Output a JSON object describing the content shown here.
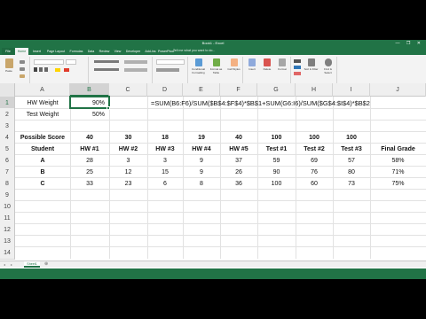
{
  "window": {
    "title": "Book1 - Excel",
    "controls": "—  ❐  ✕"
  },
  "tabs": [
    "File",
    "Home",
    "Insert",
    "Page Layout",
    "Formulas",
    "Data",
    "Review",
    "View",
    "Developer",
    "Add-ins",
    "PowerPivot"
  ],
  "tell_me": "Tell me what you want to do...",
  "ribbon_groups": [
    "Clipboard",
    "Font",
    "Alignment",
    "Number",
    "Styles",
    "Cells",
    "Editing"
  ],
  "ribbon_buttons": {
    "paste": "Paste",
    "conditional": "Conditional Formatting",
    "format_table": "Format as Table",
    "cell_styles": "Cell Styles",
    "insert": "Insert",
    "delete": "Delete",
    "format": "Format",
    "sort": "Sort & Filter",
    "find": "Find & Select"
  },
  "name_box": "B1",
  "fx_label": "fx",
  "formula": "",
  "columns": [
    "A",
    "B",
    "C",
    "D",
    "E",
    "F",
    "G",
    "H",
    "I",
    "J"
  ],
  "rows": [
    "1",
    "2",
    "3",
    "4",
    "5",
    "6",
    "7",
    "8",
    "9",
    "10",
    "11",
    "12",
    "13",
    "14"
  ],
  "cells": {
    "A1": "HW Weight",
    "B1": "90%",
    "D1": "=SUM(B6:F6)/SUM($B$4:$F$4)*$B$1+SUM(G6:I6)/SUM($G$4:$I$4)*$B$2",
    "A2": "Test Weight",
    "B2": "50%",
    "A4": "Possible Score",
    "row4": [
      "40",
      "30",
      "18",
      "19",
      "40",
      "100",
      "100",
      "100"
    ],
    "header5": [
      "Student",
      "HW #1",
      "HW #2",
      "HW #3",
      "HW #4",
      "HW #5",
      "Test #1",
      "Test #2",
      "Test #3",
      "Final Grade"
    ],
    "students": [
      {
        "name": "A",
        "scores": [
          "28",
          "3",
          "3",
          "9",
          "37",
          "59",
          "69",
          "57"
        ],
        "final": "58%"
      },
      {
        "name": "B",
        "scores": [
          "25",
          "12",
          "15",
          "9",
          "26",
          "90",
          "76",
          "80"
        ],
        "final": "71%"
      },
      {
        "name": "C",
        "scores": [
          "33",
          "23",
          "6",
          "8",
          "36",
          "100",
          "60",
          "73"
        ],
        "final": "75%"
      }
    ]
  },
  "sheet_tab": "Sheet1",
  "sheet_nav": [
    "◂",
    "▸"
  ],
  "add_sheet": "⊕",
  "colors": {
    "excel_green": "#217346",
    "selection": "#217346"
  }
}
